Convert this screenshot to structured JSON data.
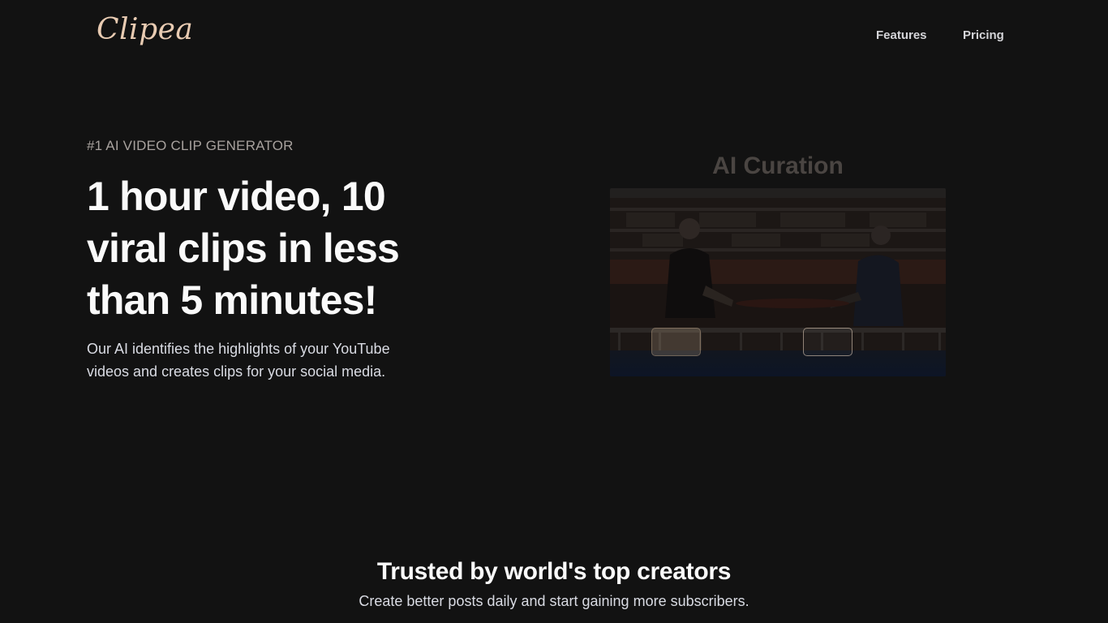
{
  "brand": {
    "logo_text": "Clipea",
    "accent": "#e8cbb2"
  },
  "nav": {
    "items": [
      {
        "label": "Features"
      },
      {
        "label": "Pricing"
      }
    ]
  },
  "hero": {
    "eyebrow": "#1 AI VIDEO CLIP GENERATOR",
    "headline": "1 hour video, 10 viral clips in less than 5 minutes!",
    "subcopy": "Our AI identifies the highlights of your YouTube videos and creates clips for your social media."
  },
  "demo": {
    "title": "AI Curation"
  },
  "trusted": {
    "title": "Trusted by world's top creators",
    "subtitle": "Create better posts daily and start gaining more subscribers."
  },
  "colors": {
    "background": "#121212",
    "text": "#fafafa",
    "muted": "#a8a29e"
  }
}
